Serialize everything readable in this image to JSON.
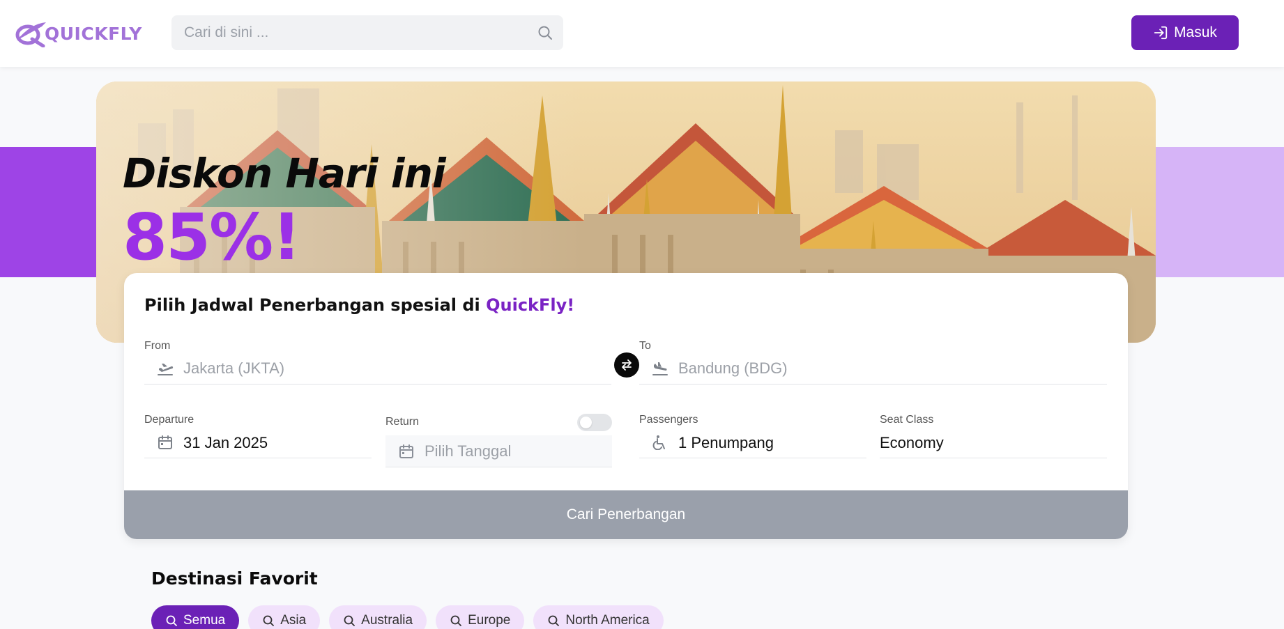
{
  "header": {
    "logo_text": "QUICKFLY",
    "search_placeholder": "Cari di sini ...",
    "login_label": "Masuk"
  },
  "hero": {
    "title": "Diskon Hari ini",
    "discount": "85%!"
  },
  "search_card": {
    "title_prefix": "Pilih Jadwal Penerbangan spesial di ",
    "title_brand": "QuickFly!",
    "from_label": "From",
    "from_placeholder": "Jakarta (JKTA)",
    "to_label": "To",
    "to_placeholder": "Bandung (BDG)",
    "departure_label": "Departure",
    "departure_value": "31 Jan 2025",
    "return_label": "Return",
    "return_placeholder": "Pilih Tanggal",
    "return_toggle_on": false,
    "passengers_label": "Passengers",
    "passengers_value": "1 Penumpang",
    "seat_class_label": "Seat Class",
    "seat_class_value": "Economy",
    "submit_label": "Cari Penerbangan"
  },
  "favorites": {
    "title": "Destinasi Favorit",
    "chips": [
      {
        "label": "Semua",
        "active": true
      },
      {
        "label": "Asia",
        "active": false
      },
      {
        "label": "Australia",
        "active": false
      },
      {
        "label": "Europe",
        "active": false
      },
      {
        "label": "North America",
        "active": false
      }
    ]
  },
  "colors": {
    "brand_purple": "#6b21b6",
    "accent_purple": "#9b30e6",
    "disabled_button": "#9aa0ab"
  },
  "icons": [
    "logo-plane-icon",
    "search-icon",
    "login-arrow-icon",
    "takeoff-icon",
    "landing-icon",
    "swap-icon",
    "calendar-icon",
    "wheelchair-icon"
  ]
}
